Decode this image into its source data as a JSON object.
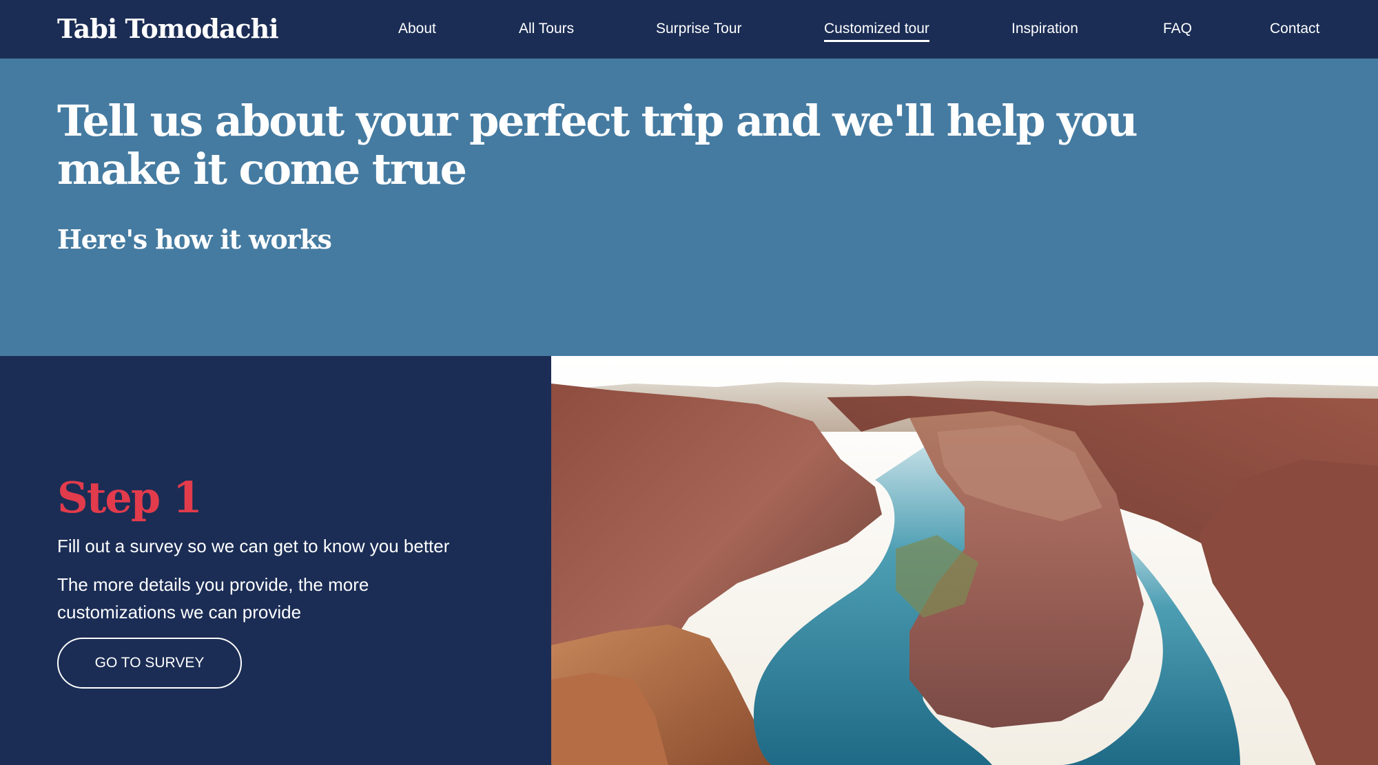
{
  "brand": "Tabi Tomodachi",
  "nav": {
    "about": "About",
    "all_tours": "All Tours",
    "surprise_tour": "Surprise Tour",
    "customized_tour": "Customized tour",
    "inspiration": "Inspiration",
    "faq": "FAQ",
    "contact": "Contact",
    "active": "Customized tour"
  },
  "hero": {
    "title": "Tell us about your perfect trip and we'll help you make it come true",
    "subtitle": "Here's how it works"
  },
  "step": {
    "title": "Step 1",
    "text1": "Fill out a survey so we can get to know you better",
    "text2": "The more details you provide, the more customizations we can provide",
    "button": "GO TO SURVEY"
  },
  "colors": {
    "navy": "#1b2d55",
    "steel_blue": "#457ba1",
    "accent_red": "#e23b4c"
  },
  "image": {
    "subject": "canyon-river-bend-photo"
  }
}
